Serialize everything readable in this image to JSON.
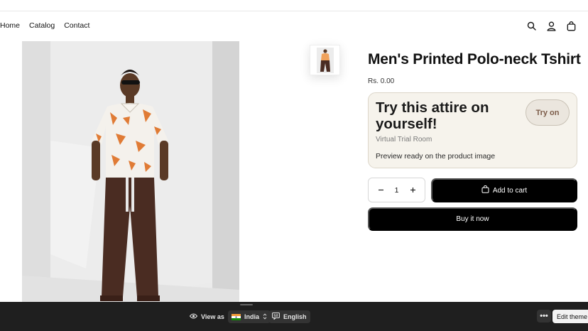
{
  "nav": {
    "items": [
      {
        "label": "Home"
      },
      {
        "label": "Catalog"
      },
      {
        "label": "Contact"
      }
    ]
  },
  "header_icons": [
    "search-icon",
    "account-icon",
    "cart-icon"
  ],
  "product": {
    "title": "Men's Printed Polo-neck Tshirt",
    "price": "Rs. 0.00"
  },
  "trial": {
    "heading": "Try this attire on yourself!",
    "subheading": "Virtual Trial Room",
    "status": "Preview ready on the product image",
    "button_label": "Try on"
  },
  "quantity": {
    "value": "1",
    "decrease_icon": "minus-icon",
    "increase_icon": "plus-icon"
  },
  "actions": {
    "add_to_cart": "Add to cart",
    "buy_now": "Buy it now"
  },
  "editor_bar": {
    "view_as": "View as",
    "country": "India",
    "language": "English",
    "edit_theme": "Edit theme"
  },
  "colors": {
    "accent": "#000000",
    "trial_background": "#f6f3ec",
    "try_on_text": "#7c5c49",
    "editor_bar": "#1f1f1f"
  }
}
